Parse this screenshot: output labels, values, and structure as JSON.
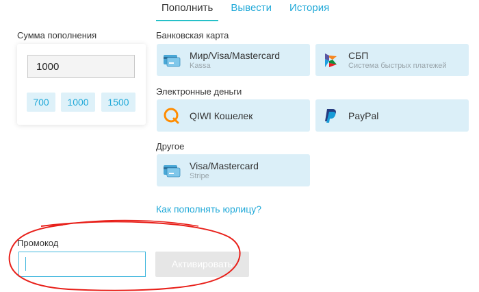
{
  "tabs": [
    {
      "label": "Пополнить",
      "active": true
    },
    {
      "label": "Вывести",
      "active": false
    },
    {
      "label": "История",
      "active": false
    }
  ],
  "amount": {
    "label": "Сумма пополнения",
    "value": "1000",
    "presets": [
      "700",
      "1000",
      "1500"
    ]
  },
  "groups": {
    "bank_card": "Банковская карта",
    "emoney": "Электронные деньги",
    "other": "Другое"
  },
  "methods": {
    "mir": {
      "title": "Мир/Visa/Mastercard",
      "subtitle": "Kassa",
      "icon": "card-icon"
    },
    "sbp": {
      "title": "СБП",
      "subtitle": "Система быстрых платежей",
      "icon": "sbp-icon"
    },
    "qiwi": {
      "title": "QIWI Кошелек",
      "icon": "qiwi-icon"
    },
    "paypal": {
      "title": "PayPal",
      "icon": "paypal-icon"
    },
    "stripe": {
      "title": "Visa/Mastercard",
      "subtitle": "Stripe",
      "icon": "card-icon"
    }
  },
  "legal_link": "Как пополнять юрлицу?",
  "promo": {
    "label": "Промокод",
    "value": "",
    "button": "Активировать"
  },
  "colors": {
    "accent": "#21a9d8",
    "tab_underline": "#26c0c8",
    "tile_bg": "#dbeff8",
    "annotation": "#e8201a"
  }
}
